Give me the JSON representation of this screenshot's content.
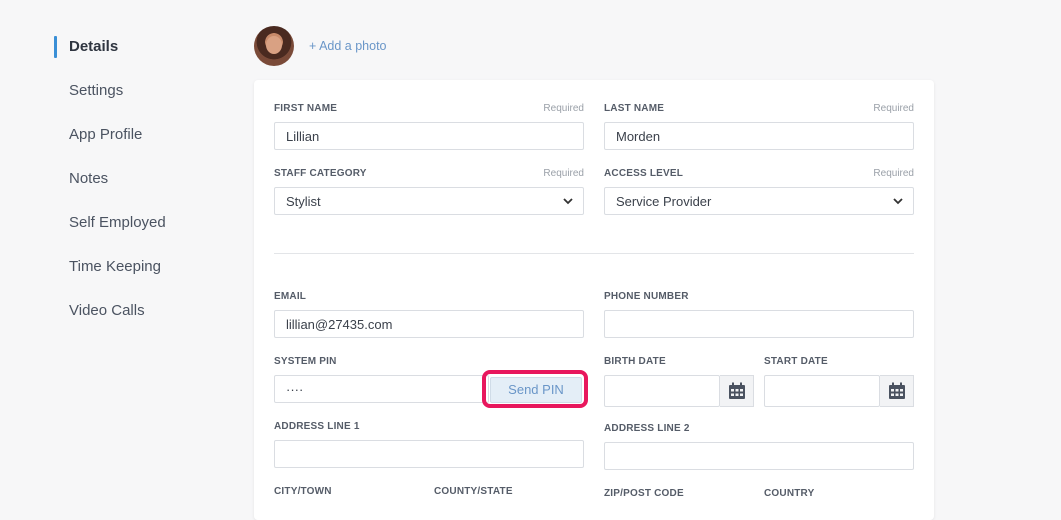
{
  "sidebar": {
    "items": [
      {
        "label": "Details"
      },
      {
        "label": "Settings"
      },
      {
        "label": "App Profile"
      },
      {
        "label": "Notes"
      },
      {
        "label": "Self Employed"
      },
      {
        "label": "Time Keeping"
      },
      {
        "label": "Video Calls"
      }
    ]
  },
  "photo": {
    "add_label": "+ Add a photo"
  },
  "form": {
    "required_text": "Required",
    "first_name": {
      "label": "FIRST NAME",
      "value": "Lillian"
    },
    "last_name": {
      "label": "LAST NAME",
      "value": "Morden"
    },
    "staff_category": {
      "label": "STAFF CATEGORY",
      "value": "Stylist"
    },
    "access_level": {
      "label": "ACCESS LEVEL",
      "value": "Service Provider"
    },
    "email": {
      "label": "EMAIL",
      "value": "lillian@27435.com"
    },
    "phone": {
      "label": "PHONE NUMBER",
      "value": ""
    },
    "system_pin": {
      "label": "SYSTEM PIN",
      "value": "····"
    },
    "send_pin_label": "Send PIN",
    "birth_date": {
      "label": "BIRTH DATE",
      "value": ""
    },
    "start_date": {
      "label": "START DATE",
      "value": ""
    },
    "address1": {
      "label": "ADDRESS LINE 1",
      "value": ""
    },
    "address2": {
      "label": "ADDRESS LINE 2",
      "value": ""
    },
    "city": {
      "label": "CITY/TOWN"
    },
    "county": {
      "label": "COUNTY/STATE"
    },
    "zip": {
      "label": "ZIP/POST CODE"
    },
    "country": {
      "label": "COUNTRY"
    }
  },
  "colors": {
    "accent": "#3a8fd6",
    "highlight": "#e8175d",
    "link": "#6a96c8"
  }
}
